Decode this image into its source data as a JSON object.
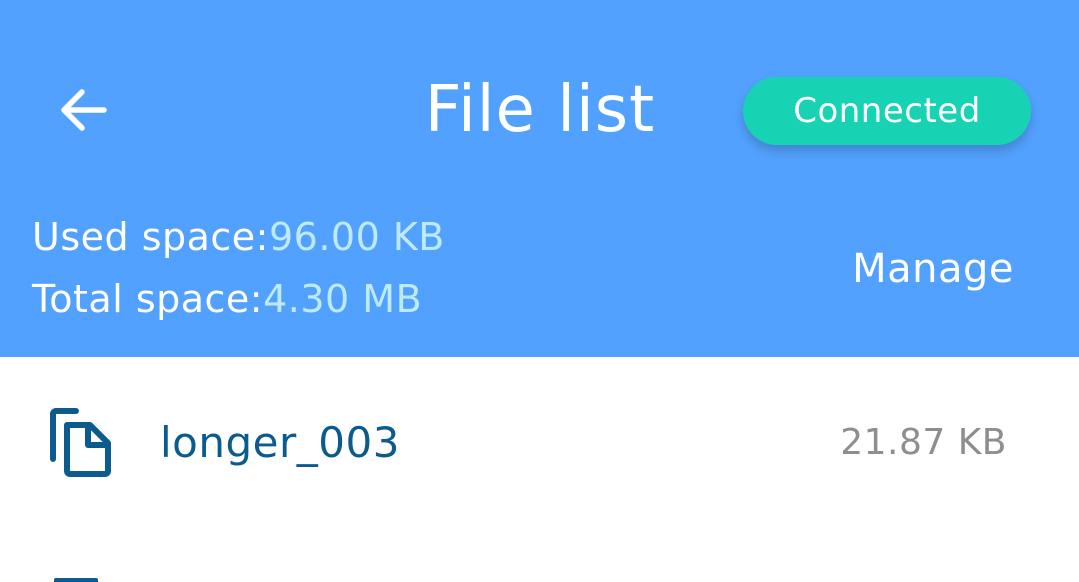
{
  "header": {
    "title": "File list",
    "status": "Connected",
    "used_label": "Used space:",
    "used_value": "96.00 KB",
    "total_label": "Total space:",
    "total_value": "4.30 MB",
    "manage_label": "Manage"
  },
  "files": [
    {
      "name": "longer_003",
      "size": "21.87 KB",
      "icon": "file-copy-icon"
    }
  ],
  "colors": {
    "header_bg": "#52a1fe",
    "status_bg": "#17d3b4",
    "value_text": "#bdeaff",
    "file_name": "#0b5b8e",
    "file_size": "#8e8e8e"
  }
}
